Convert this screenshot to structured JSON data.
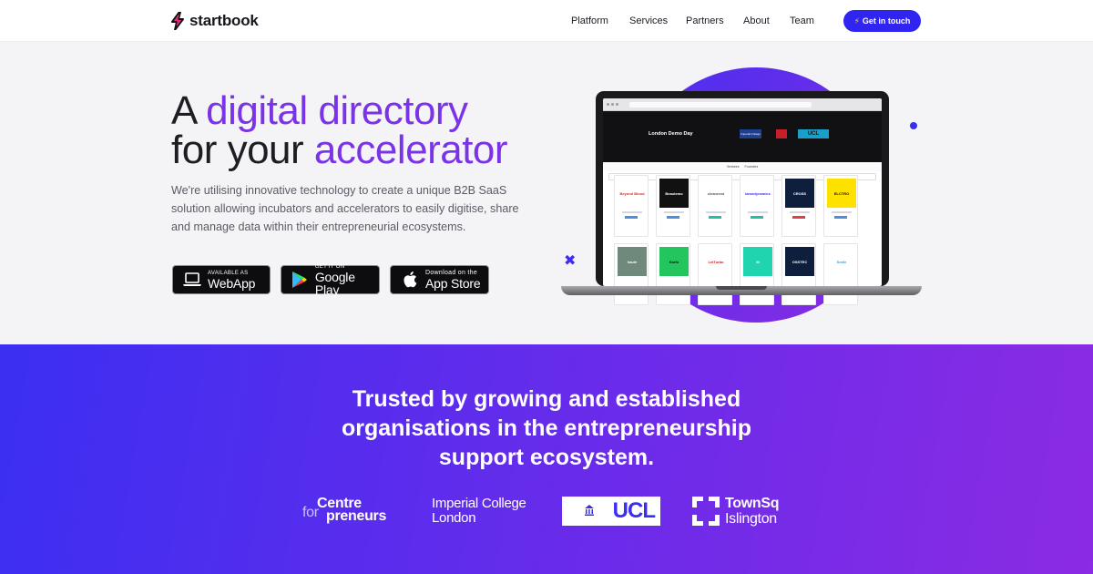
{
  "nav": {
    "brand": "startbook",
    "links": [
      {
        "label": "Platform"
      },
      {
        "label": "Services"
      },
      {
        "label": "Partners"
      },
      {
        "label": "About"
      },
      {
        "label": "Team"
      }
    ],
    "cta_label": "Get in touch",
    "cta_icon": "lightning-icon"
  },
  "hero": {
    "headline_part1": "A ",
    "headline_accent1": "digital directory",
    "headline_part2": "for your ",
    "headline_accent2": "accelerator",
    "description": "We're utilising innovative technology to create a unique B2B SaaS solution allowing incubators and accelerators to easily digitise, share and manage data within their entrepreneurial ecosystems.",
    "store_buttons": [
      {
        "small": "AVAILABLE AS",
        "big": "WebApp",
        "icon": "laptop-icon"
      },
      {
        "small": "GET IT ON",
        "big": "Google Play",
        "icon": "google-play-icon"
      },
      {
        "small": "Download on the",
        "big": "App Store",
        "icon": "apple-icon"
      }
    ]
  },
  "laptop_screen": {
    "event_title": "London Demo Day",
    "logos": [
      "Imperial College",
      "UCL"
    ],
    "tabs": [
      "Ventures",
      "Founders"
    ],
    "cards": [
      {
        "name": "Beyond Blood",
        "bg": "#ffffff",
        "fg": "#d03030"
      },
      {
        "name": "Beautemo",
        "bg": "#111111",
        "fg": "#ffffff"
      },
      {
        "name": "cleannest",
        "bg": "#ffffff",
        "fg": "#555555"
      },
      {
        "name": "lamodynamics",
        "bg": "#ffffff",
        "fg": "#3a2ff0"
      },
      {
        "name": "CROSS",
        "bg": "#0d1f3c",
        "fg": "#ffffff"
      },
      {
        "name": "ELCTRO",
        "bg": "#ffe100",
        "fg": "#111111"
      },
      {
        "name": "haule",
        "bg": "#6f8a7c",
        "fg": "#ffffff"
      },
      {
        "name": "Karfu",
        "bg": "#22c55e",
        "fg": "#111111"
      },
      {
        "name": "LetTurbo",
        "bg": "#ffffff",
        "fg": "#d32020"
      },
      {
        "name": "M",
        "bg": "#20d4b0",
        "fg": "#ffffff"
      },
      {
        "name": "OSSTEC",
        "bg": "#0d1f3c",
        "fg": "#ffffff"
      },
      {
        "name": "Smile",
        "bg": "#ffffff",
        "fg": "#3aa0e0"
      }
    ]
  },
  "trust": {
    "title_lines": [
      "Trusted by growing and established",
      "organisations in the entrepreneurship",
      "support ecosystem."
    ],
    "partners": {
      "cfe_line1": "Centre",
      "cfe_for": "for",
      "cfe_line2": "preneurs",
      "icl_line1": "Imperial College",
      "icl_line2": "London",
      "ucl": "UCL",
      "townsq_line1": "TownSq",
      "townsq_line2": "Islington"
    }
  },
  "colors": {
    "accent": "#7a33e6",
    "cta": "#2f24f0",
    "gradient_start": "#3b2ff2",
    "gradient_end": "#8b2be3"
  }
}
